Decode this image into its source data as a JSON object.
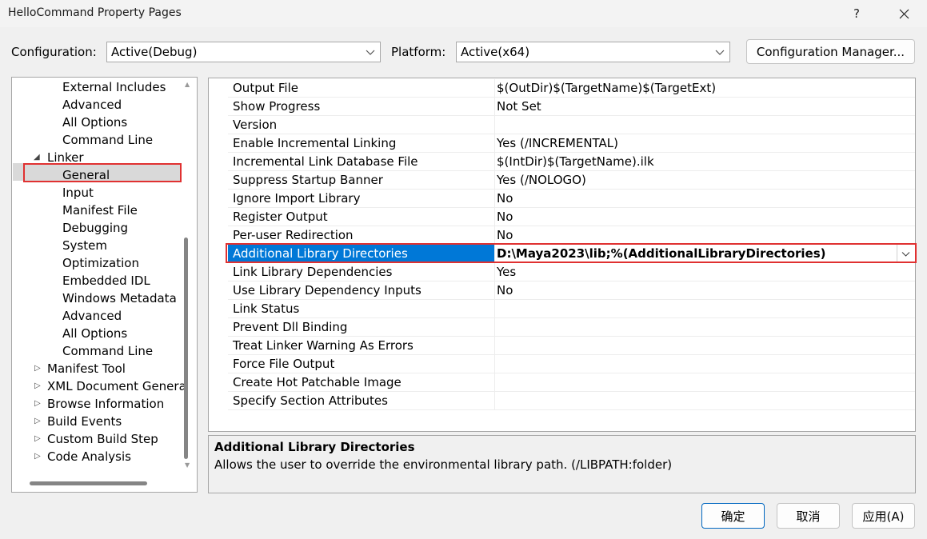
{
  "window": {
    "title": "HelloCommand Property Pages",
    "help": "?",
    "close_icon": "close-icon"
  },
  "toolbar": {
    "configuration_label": "Configuration:",
    "configuration_value": "Active(Debug)",
    "platform_label": "Platform:",
    "platform_value": "Active(x64)",
    "config_manager": "Configuration Manager..."
  },
  "tree": {
    "items": [
      {
        "label": "External Includes"
      },
      {
        "label": "Advanced"
      },
      {
        "label": "All Options"
      },
      {
        "label": "Command Line"
      },
      {
        "label": "Linker",
        "expander": "expanded"
      },
      {
        "label": "General",
        "selected": true
      },
      {
        "label": "Input"
      },
      {
        "label": "Manifest File"
      },
      {
        "label": "Debugging"
      },
      {
        "label": "System"
      },
      {
        "label": "Optimization"
      },
      {
        "label": "Embedded IDL"
      },
      {
        "label": "Windows Metadata"
      },
      {
        "label": "Advanced"
      },
      {
        "label": "All Options"
      },
      {
        "label": "Command Line"
      },
      {
        "label": "Manifest Tool",
        "expander": "collapsed"
      },
      {
        "label": "XML Document Genera",
        "expander": "collapsed"
      },
      {
        "label": "Browse Information",
        "expander": "collapsed"
      },
      {
        "label": "Build Events",
        "expander": "collapsed"
      },
      {
        "label": "Custom Build Step",
        "expander": "collapsed"
      },
      {
        "label": "Code Analysis",
        "expander": "collapsed"
      }
    ]
  },
  "grid": {
    "rows": [
      {
        "name": "Output File",
        "value": "$(OutDir)$(TargetName)$(TargetExt)"
      },
      {
        "name": "Show Progress",
        "value": "Not Set"
      },
      {
        "name": "Version",
        "value": ""
      },
      {
        "name": "Enable Incremental Linking",
        "value": "Yes (/INCREMENTAL)"
      },
      {
        "name": "Incremental Link Database File",
        "value": "$(IntDir)$(TargetName).ilk"
      },
      {
        "name": "Suppress Startup Banner",
        "value": "Yes (/NOLOGO)"
      },
      {
        "name": "Ignore Import Library",
        "value": "No"
      },
      {
        "name": "Register Output",
        "value": "No"
      },
      {
        "name": "Per-user Redirection",
        "value": "No"
      },
      {
        "name": "Additional Library Directories",
        "value": "D:\\Maya2023\\lib;%(AdditionalLibraryDirectories)",
        "selected": true
      },
      {
        "name": "Link Library Dependencies",
        "value": "Yes"
      },
      {
        "name": "Use Library Dependency Inputs",
        "value": "No"
      },
      {
        "name": "Link Status",
        "value": ""
      },
      {
        "name": "Prevent Dll Binding",
        "value": ""
      },
      {
        "name": "Treat Linker Warning As Errors",
        "value": ""
      },
      {
        "name": "Force File Output",
        "value": ""
      },
      {
        "name": "Create Hot Patchable Image",
        "value": ""
      },
      {
        "name": "Specify Section Attributes",
        "value": ""
      }
    ]
  },
  "description": {
    "title": "Additional Library Directories",
    "text": "Allows the user to override the environmental library path. (/LIBPATH:folder)"
  },
  "buttons": {
    "ok": "确定",
    "cancel": "取消",
    "apply": "应用(A)"
  },
  "colors": {
    "selection": "#0078d7",
    "highlight_box": "#e03131",
    "tree_selection": "#d9d9d9"
  }
}
